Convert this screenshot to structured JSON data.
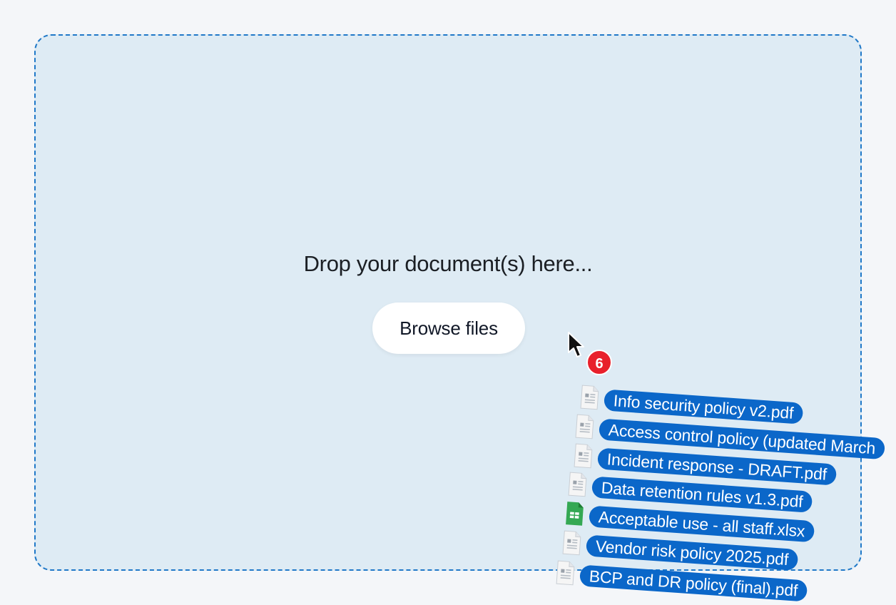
{
  "dropzone": {
    "prompt": "Drop your document(s) here...",
    "browse_label": "Browse files"
  },
  "drag": {
    "count": "6",
    "files": [
      {
        "name": "Info security policy v2.pdf",
        "icon": "pdf-file-icon"
      },
      {
        "name": "Access control policy (updated March",
        "icon": "pdf-file-icon"
      },
      {
        "name": "Incident response - DRAFT.pdf",
        "icon": "pdf-file-icon"
      },
      {
        "name": "Data retention rules v1.3.pdf",
        "icon": "pdf-file-icon"
      },
      {
        "name": "Acceptable use - all staff.xlsx",
        "icon": "spreadsheet-file-icon"
      },
      {
        "name": "Vendor risk policy 2025.pdf",
        "icon": "pdf-file-icon"
      },
      {
        "name": "BCP and DR policy (final).pdf",
        "icon": "pdf-file-icon"
      }
    ]
  },
  "colors": {
    "accent": "#0b67c9",
    "dropzone_border": "#1f78c8",
    "dropzone_fill": "#deebf4",
    "badge": "#e8202b",
    "spreadsheet": "#34a853"
  }
}
